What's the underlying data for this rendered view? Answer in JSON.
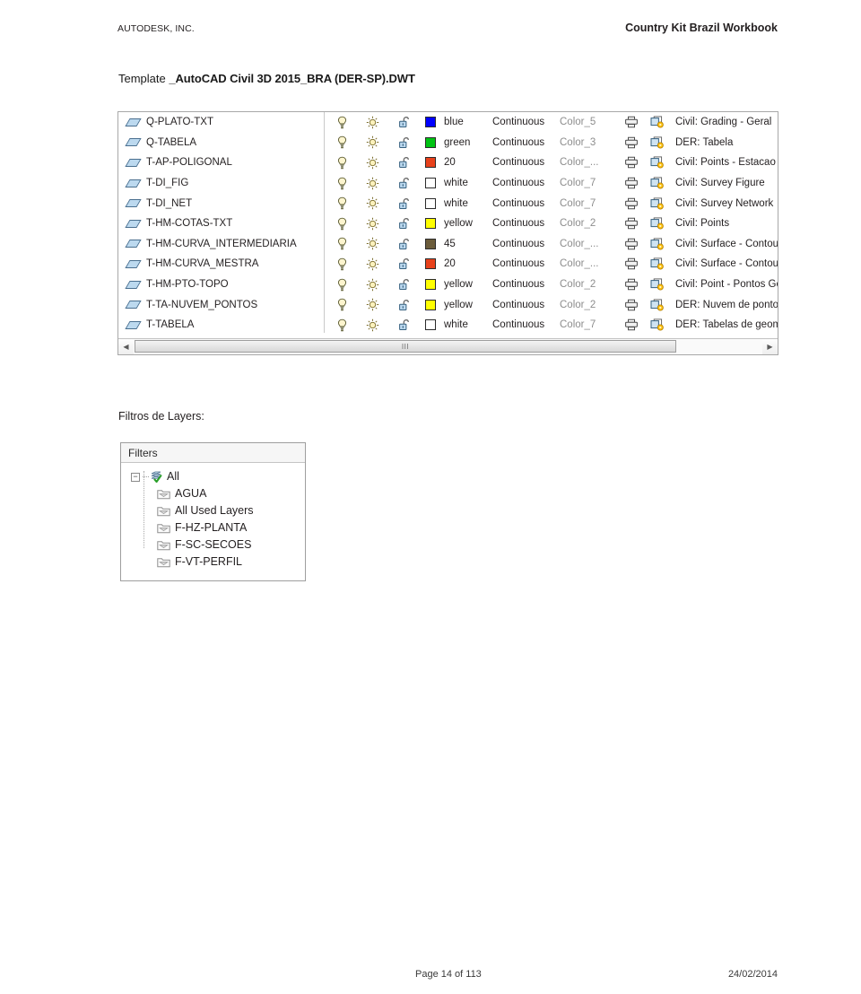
{
  "document": {
    "header_left": "AUTODESK, INC.",
    "header_right": "Country Kit Brazil Workbook",
    "template_lead": "Template ",
    "template_name": "_AutoCAD Civil 3D 2015_BRA (DER-SP).DWT",
    "footer_page": "Page 14 of 113",
    "footer_date": "24/02/2014"
  },
  "layer_table": {
    "icons": {
      "layer": "layer-icon",
      "on": "lightbulb-on-icon",
      "freeze": "sun-thaw-icon",
      "lock": "padlock-open-icon",
      "plot": "printer-icon",
      "vp_freeze": "viewport-override-icon"
    },
    "scrollbar": {
      "left_arrow": "◀",
      "right_arrow": "▶",
      "grip": "III"
    },
    "rows": [
      {
        "name": "Q-PLATO-TXT",
        "color_name": "blue",
        "color_hex": "#0000FF",
        "linetype": "Continuous",
        "plotstyle": "Color_5",
        "description": "Civil: Grading - Geral"
      },
      {
        "name": "Q-TABELA",
        "color_name": "green",
        "color_hex": "#00C313",
        "linetype": "Continuous",
        "plotstyle": "Color_3",
        "description": "DER: Tabela"
      },
      {
        "name": "T-AP-POLIGONAL",
        "color_name": "20",
        "color_hex": "#E8411B",
        "linetype": "Continuous",
        "plotstyle": "Color_...",
        "description": "Civil: Points - Estacao de P"
      },
      {
        "name": "T-DI_FIG",
        "color_name": "white",
        "color_hex": "#FFFFFF",
        "linetype": "Continuous",
        "plotstyle": "Color_7",
        "description": "Civil: Survey Figure"
      },
      {
        "name": "T-DI_NET",
        "color_name": "white",
        "color_hex": "#FFFFFF",
        "linetype": "Continuous",
        "plotstyle": "Color_7",
        "description": "Civil: Survey Network"
      },
      {
        "name": "T-HM-COTAS-TXT",
        "color_name": "yellow",
        "color_hex": "#FFFF00",
        "linetype": "Continuous",
        "plotstyle": "Color_2",
        "description": "Civil: Points"
      },
      {
        "name": "T-HM-CURVA_INTERMEDIARIA",
        "color_name": "45",
        "color_hex": "#6B5C3B",
        "linetype": "Continuous",
        "plotstyle": "Color_...",
        "description": "Civil: Surface - Contour M"
      },
      {
        "name": "T-HM-CURVA_MESTRA",
        "color_name": "20",
        "color_hex": "#E8411B",
        "linetype": "Continuous",
        "plotstyle": "Color_...",
        "description": "Civil: Surface - Contour M"
      },
      {
        "name": "T-HM-PTO-TOPO",
        "color_name": "yellow",
        "color_hex": "#FFFF00",
        "linetype": "Continuous",
        "plotstyle": "Color_2",
        "description": "Civil: Point - Pontos Geral"
      },
      {
        "name": "T-TA-NUVEM_PONTOS",
        "color_name": "yellow",
        "color_hex": "#FFFF00",
        "linetype": "Continuous",
        "plotstyle": "Color_2",
        "description": "DER: Nuvem de pontos"
      },
      {
        "name": "T-TABELA",
        "color_name": "white",
        "color_hex": "#FFFFFF",
        "linetype": "Continuous",
        "plotstyle": "Color_7",
        "description": "DER: Tabelas de geometri"
      }
    ]
  },
  "filters_section": {
    "caption": "Filtros de Layers:",
    "panel_title": "Filters",
    "root": {
      "label": "All",
      "expander": "−"
    },
    "children": [
      {
        "label": "AGUA"
      },
      {
        "label": "All Used Layers"
      },
      {
        "label": "F-HZ-PLANTA"
      },
      {
        "label": "F-SC-SECOES"
      },
      {
        "label": "F-VT-PERFIL"
      }
    ]
  }
}
